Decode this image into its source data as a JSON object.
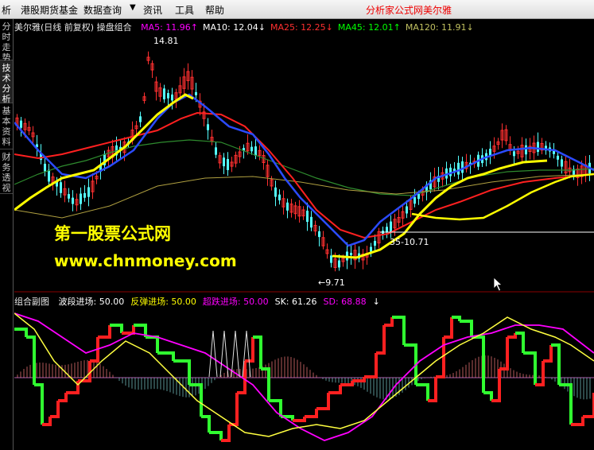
{
  "menubar": {
    "items": [
      "析",
      "港股期货基金",
      "数据查询",
      "资讯",
      "工具",
      "帮助"
    ],
    "arrow": "▼",
    "right_links": [
      "分析家公式网",
      "美尔雅"
    ]
  },
  "sidebar": {
    "tabs": [
      "分时走势",
      "技术分析",
      "基本资料",
      "财务透视"
    ]
  },
  "main_chart": {
    "title": "美尔雅(日线 前复权) 操盘组合",
    "ma": [
      {
        "label": "MA5: 11.96",
        "arrow": "↑",
        "color": "#ff00ff"
      },
      {
        "label": "MA10: 12.04",
        "arrow": "↓",
        "color": "#ffffff"
      },
      {
        "label": "MA25: 12.25",
        "arrow": "↓",
        "color": "#ff3030"
      },
      {
        "label": "MA45: 12.01",
        "arrow": "↑",
        "color": "#00ff00"
      },
      {
        "label": "MA120: 11.91",
        "arrow": "↓",
        "color": "#c0c060"
      }
    ],
    "high_label": "14.81",
    "low_label": "←9.71",
    "mid_label": "35-10.71",
    "watermark_title": "第一股票公式网",
    "watermark_url": "www.chnmoney.com"
  },
  "sub_chart": {
    "title": "组合副图",
    "items": [
      {
        "label": "波段进场: 50.00",
        "color": "#ffffff"
      },
      {
        "label": "反弹进场: 50.00",
        "color": "#ffff00"
      },
      {
        "label": "超跌进场: 50.00",
        "color": "#ff00ff"
      },
      {
        "label": "SK: 61.26",
        "color": "#ffffff"
      },
      {
        "label": "SD: 68.88",
        "color": "#ff00ff"
      },
      {
        "label": "↓",
        "color": "#ffffff"
      }
    ]
  },
  "colors": {
    "up_candle": "#ff3030",
    "down_candle": "#54ffff",
    "ma_blue": "#2b4bff",
    "ma_red": "#ff2020",
    "ma_yellow": "#ffff00",
    "ma_green": "#2e8b2e",
    "kd_magenta": "#ff00ff",
    "kd_yellow": "#ffff40"
  }
}
